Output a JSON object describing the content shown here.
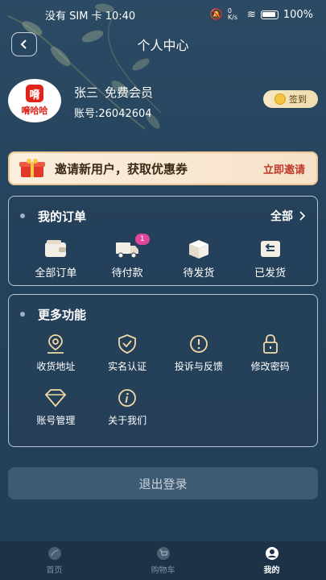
{
  "status_bar": {
    "carrier_time": "没有 SIM 卡 10:40",
    "speed": "0 K/s",
    "battery": "100%"
  },
  "nav": {
    "title": "个人中心"
  },
  "profile": {
    "avatar_logo": "嗋",
    "avatar_text": "嗋哈哈",
    "name": "张三",
    "level": "免费会员",
    "account": "账号:26042604",
    "signin_label": "签到"
  },
  "invite": {
    "text": "邀请新用户，获取优惠券",
    "action": "立即邀请"
  },
  "orders": {
    "title": "我的订单",
    "all_label": "全部",
    "items": [
      {
        "label": "全部订单",
        "icon": "wallet-icon"
      },
      {
        "label": "待付款",
        "icon": "truck-icon",
        "badge": "1"
      },
      {
        "label": "待发货",
        "icon": "box-icon"
      },
      {
        "label": "已发货",
        "icon": "return-icon"
      }
    ]
  },
  "more": {
    "title": "更多功能",
    "items": [
      {
        "label": "收货地址",
        "icon": "location-icon"
      },
      {
        "label": "实名认证",
        "icon": "shield-check-icon"
      },
      {
        "label": "投诉与反馈",
        "icon": "alert-icon"
      },
      {
        "label": "修改密码",
        "icon": "lock-icon"
      },
      {
        "label": "账号管理",
        "icon": "diamond-icon"
      },
      {
        "label": "关于我们",
        "icon": "info-icon"
      }
    ]
  },
  "logout_label": "退出登录",
  "tabs": [
    {
      "label": "首页",
      "icon": "home-icon",
      "active": false
    },
    {
      "label": "购物车",
      "icon": "cart-icon",
      "active": false
    },
    {
      "label": "我的",
      "icon": "user-icon",
      "active": true
    }
  ],
  "colors": {
    "accent": "#e2231a",
    "badge": "#e0479b",
    "background": "#23405a",
    "invite_action": "#c0392b"
  }
}
